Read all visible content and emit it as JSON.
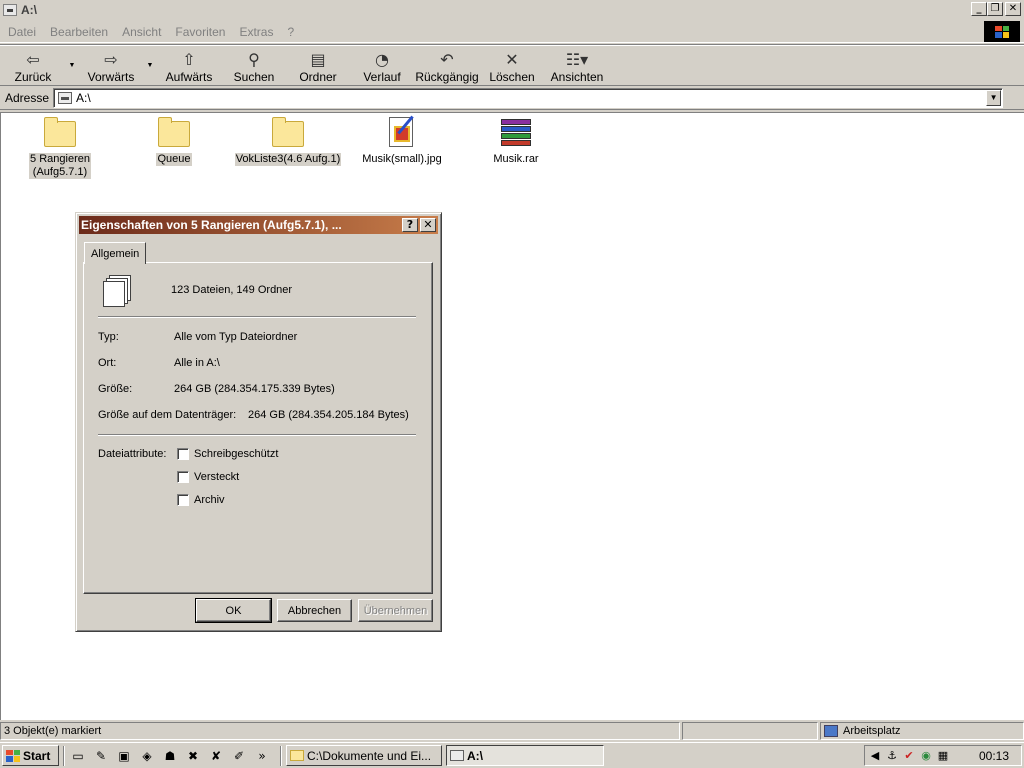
{
  "window": {
    "title": "A:\\"
  },
  "menu": {
    "items": [
      "Datei",
      "Bearbeiten",
      "Ansicht",
      "Favoriten",
      "Extras",
      "?"
    ]
  },
  "toolbar": {
    "back": "Zurück",
    "forward": "Vorwärts",
    "up": "Aufwärts",
    "search": "Suchen",
    "folders": "Ordner",
    "history": "Verlauf",
    "undo": "Rückgängig",
    "delete": "Löschen",
    "views": "Ansichten"
  },
  "address": {
    "label": "Adresse",
    "value": "A:\\"
  },
  "files": [
    {
      "name": "5 Rangieren\n(Aufg5.7.1)",
      "type": "folder",
      "selected": true
    },
    {
      "name": "Queue",
      "type": "folder",
      "selected": true
    },
    {
      "name": "VokListe3(4.6 Aufg.1)",
      "type": "folder",
      "selected": true
    },
    {
      "name": "Musik(small).jpg",
      "type": "jpg",
      "selected": false
    },
    {
      "name": "Musik.rar",
      "type": "rar",
      "selected": false
    }
  ],
  "dialog": {
    "title": "Eigenschaften von 5 Rangieren (Aufg5.7.1), ...",
    "tab": "Allgemein",
    "summary": "123 Dateien, 149 Ordner",
    "type_label": "Typ:",
    "type_value": "Alle vom Typ Dateiordner",
    "location_label": "Ort:",
    "location_value": "Alle in A:\\",
    "size_label": "Größe:",
    "size_value": "264 GB (284.354.175.339 Bytes)",
    "disk_size_label": "Größe auf dem Datenträger:",
    "disk_size_value": "264 GB (284.354.205.184 Bytes)",
    "attributes_label": "Dateiattribute:",
    "attr_readonly": "Schreibgeschützt",
    "attr_hidden": "Versteckt",
    "attr_archive": "Archiv",
    "ok": "OK",
    "cancel": "Abbrechen",
    "apply": "Übernehmen"
  },
  "status": {
    "selected": "3 Objekt(e) markiert",
    "zone": "Arbeitsplatz"
  },
  "taskbar": {
    "start": "Start",
    "task1": "C:\\Dokumente und Ei...",
    "task2": "A:\\",
    "clock": "00:13"
  },
  "colors": {
    "title_start": "#6b2a1a",
    "title_end": "#c87d4a",
    "face": "#d4d0c8"
  }
}
